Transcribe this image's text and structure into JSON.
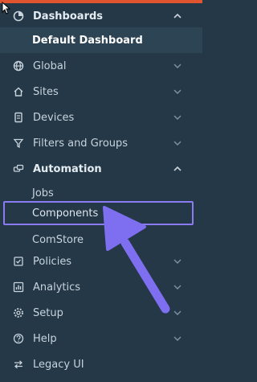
{
  "colors": {
    "accent_top": "#e0542f",
    "sidebar_bg": "#243847",
    "highlight": "#8a7cf0",
    "arrow": "#7e6ff0"
  },
  "sidebar": {
    "items": [
      {
        "label": "Dashboards",
        "icon": "dashboard-icon"
      },
      {
        "label": "Default Dashboard"
      },
      {
        "label": "Global",
        "icon": "globe-icon"
      },
      {
        "label": "Sites",
        "icon": "home-icon"
      },
      {
        "label": "Devices",
        "icon": "device-icon"
      },
      {
        "label": "Filters and Groups",
        "icon": "filter-icon"
      },
      {
        "label": "Automation",
        "icon": "automation-icon"
      },
      {
        "label": "Jobs"
      },
      {
        "label": "Components"
      },
      {
        "label": "ComStore"
      },
      {
        "label": "Policies",
        "icon": "policies-icon"
      },
      {
        "label": "Analytics",
        "icon": "analytics-icon"
      },
      {
        "label": "Setup",
        "icon": "gear-icon"
      },
      {
        "label": "Help",
        "icon": "help-icon"
      },
      {
        "label": "Legacy UI",
        "icon": "swap-icon"
      }
    ]
  }
}
